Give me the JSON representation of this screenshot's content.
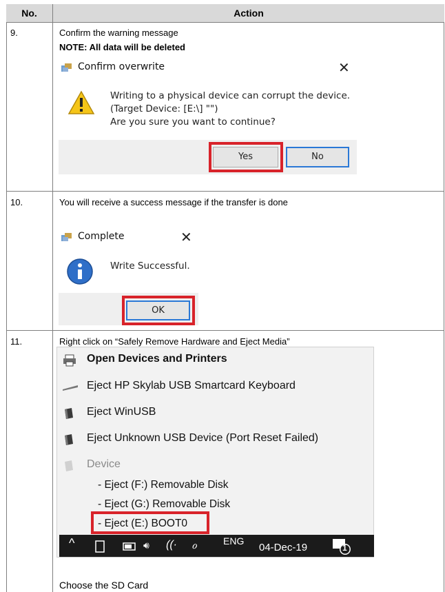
{
  "table": {
    "col_no": "No.",
    "col_action": "Action"
  },
  "rows": [
    {
      "no": "9.",
      "line1": "Confirm the warning message",
      "line2": "NOTE: All data will be deleted",
      "dialog": {
        "title": "Confirm overwrite",
        "message": [
          "Writing to a physical device can corrupt the device.",
          "(Target Device: [E:\\] \"\")",
          "Are you sure you want to continue?"
        ],
        "yes_label": "Yes",
        "no_label": "No"
      }
    },
    {
      "no": "10.",
      "line1": "You will receive a success message if the transfer is done",
      "dialog": {
        "title": "Complete",
        "message": "Write Successful.",
        "ok_label": "OK"
      }
    },
    {
      "no": "11.",
      "line1": "Right click on “Safely Remove Hardware and Eject Media”",
      "menu": {
        "open_devices": "Open Devices and Printers",
        "items": [
          "Eject HP Skylab USB Smartcard Keyboard",
          "Eject WinUSB",
          "Eject Unknown USB Device (Port Reset Failed)"
        ],
        "device_header": "Device",
        "sub_items": [
          "- Eject (F:) Removable Disk",
          "- Eject (G:) Removable Disk",
          "- Eject (E:) BOOT0"
        ]
      },
      "taskbar": {
        "lang": "ENG",
        "date": "04-Dec-19",
        "notifications": "1"
      },
      "line2": "Choose the SD Card"
    }
  ],
  "colors": {
    "highlight": "#d8232a",
    "header_bg": "#d9d9d9",
    "primary_border": "#2a78d6",
    "taskbar_bg": "#1b1b1b"
  }
}
